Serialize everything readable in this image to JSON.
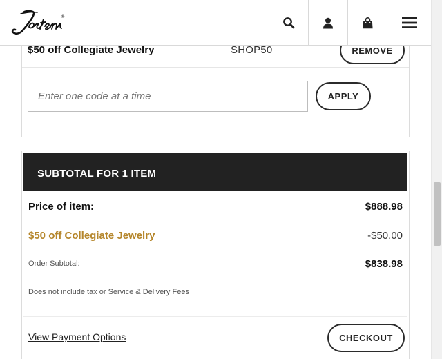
{
  "header": {
    "brand": "Jostens",
    "icons": [
      "search-icon",
      "account-icon",
      "cart-icon",
      "menu-icon"
    ]
  },
  "promo": {
    "applied": {
      "name": "$50 off Collegiate Jewelry",
      "code": "SHOP50",
      "remove_label": "REMOVE"
    },
    "input_placeholder": "Enter one code at a time",
    "apply_label": "APPLY"
  },
  "subtotal": {
    "title": "SUBTOTAL FOR 1 ITEM",
    "price_label": "Price of item:",
    "price_value": "$888.98",
    "discount_label": "$50 off Collegiate Jewelry",
    "discount_value": "-$50.00",
    "order_subtotal_label": "Order Subtotal:",
    "order_subtotal_value": "$838.98",
    "note": "Does not include tax or Service & Delivery Fees",
    "payment_link": "View Payment Options",
    "checkout_label": "CHECKOUT"
  },
  "colors": {
    "accent_gold": "#b5862b",
    "header_dark": "#222222"
  }
}
